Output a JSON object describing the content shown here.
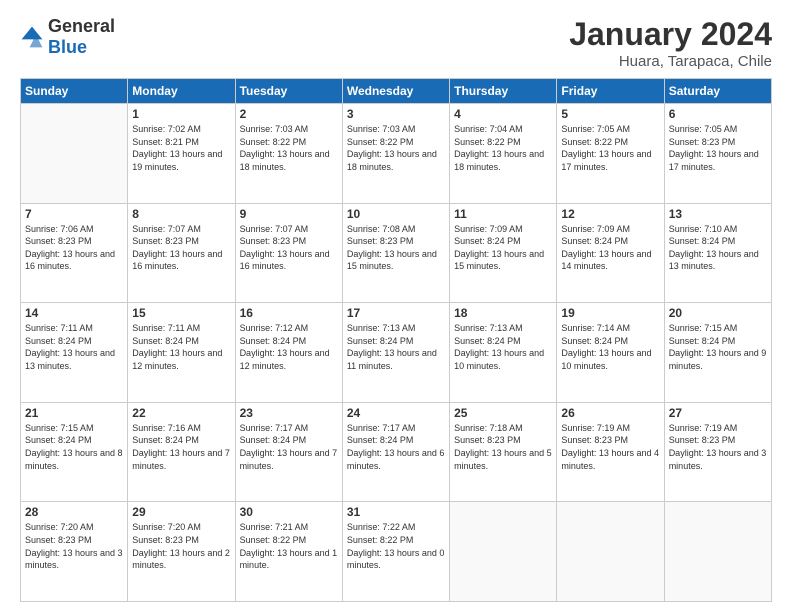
{
  "logo": {
    "general": "General",
    "blue": "Blue"
  },
  "title": "January 2024",
  "subtitle": "Huara, Tarapaca, Chile",
  "headers": [
    "Sunday",
    "Monday",
    "Tuesday",
    "Wednesday",
    "Thursday",
    "Friday",
    "Saturday"
  ],
  "weeks": [
    [
      {
        "day": "",
        "sunrise": "",
        "sunset": "",
        "daylight": ""
      },
      {
        "day": "1",
        "sunrise": "Sunrise: 7:02 AM",
        "sunset": "Sunset: 8:21 PM",
        "daylight": "Daylight: 13 hours and 19 minutes."
      },
      {
        "day": "2",
        "sunrise": "Sunrise: 7:03 AM",
        "sunset": "Sunset: 8:22 PM",
        "daylight": "Daylight: 13 hours and 18 minutes."
      },
      {
        "day": "3",
        "sunrise": "Sunrise: 7:03 AM",
        "sunset": "Sunset: 8:22 PM",
        "daylight": "Daylight: 13 hours and 18 minutes."
      },
      {
        "day": "4",
        "sunrise": "Sunrise: 7:04 AM",
        "sunset": "Sunset: 8:22 PM",
        "daylight": "Daylight: 13 hours and 18 minutes."
      },
      {
        "day": "5",
        "sunrise": "Sunrise: 7:05 AM",
        "sunset": "Sunset: 8:22 PM",
        "daylight": "Daylight: 13 hours and 17 minutes."
      },
      {
        "day": "6",
        "sunrise": "Sunrise: 7:05 AM",
        "sunset": "Sunset: 8:23 PM",
        "daylight": "Daylight: 13 hours and 17 minutes."
      }
    ],
    [
      {
        "day": "7",
        "sunrise": "Sunrise: 7:06 AM",
        "sunset": "Sunset: 8:23 PM",
        "daylight": "Daylight: 13 hours and 16 minutes."
      },
      {
        "day": "8",
        "sunrise": "Sunrise: 7:07 AM",
        "sunset": "Sunset: 8:23 PM",
        "daylight": "Daylight: 13 hours and 16 minutes."
      },
      {
        "day": "9",
        "sunrise": "Sunrise: 7:07 AM",
        "sunset": "Sunset: 8:23 PM",
        "daylight": "Daylight: 13 hours and 16 minutes."
      },
      {
        "day": "10",
        "sunrise": "Sunrise: 7:08 AM",
        "sunset": "Sunset: 8:23 PM",
        "daylight": "Daylight: 13 hours and 15 minutes."
      },
      {
        "day": "11",
        "sunrise": "Sunrise: 7:09 AM",
        "sunset": "Sunset: 8:24 PM",
        "daylight": "Daylight: 13 hours and 15 minutes."
      },
      {
        "day": "12",
        "sunrise": "Sunrise: 7:09 AM",
        "sunset": "Sunset: 8:24 PM",
        "daylight": "Daylight: 13 hours and 14 minutes."
      },
      {
        "day": "13",
        "sunrise": "Sunrise: 7:10 AM",
        "sunset": "Sunset: 8:24 PM",
        "daylight": "Daylight: 13 hours and 13 minutes."
      }
    ],
    [
      {
        "day": "14",
        "sunrise": "Sunrise: 7:11 AM",
        "sunset": "Sunset: 8:24 PM",
        "daylight": "Daylight: 13 hours and 13 minutes."
      },
      {
        "day": "15",
        "sunrise": "Sunrise: 7:11 AM",
        "sunset": "Sunset: 8:24 PM",
        "daylight": "Daylight: 13 hours and 12 minutes."
      },
      {
        "day": "16",
        "sunrise": "Sunrise: 7:12 AM",
        "sunset": "Sunset: 8:24 PM",
        "daylight": "Daylight: 13 hours and 12 minutes."
      },
      {
        "day": "17",
        "sunrise": "Sunrise: 7:13 AM",
        "sunset": "Sunset: 8:24 PM",
        "daylight": "Daylight: 13 hours and 11 minutes."
      },
      {
        "day": "18",
        "sunrise": "Sunrise: 7:13 AM",
        "sunset": "Sunset: 8:24 PM",
        "daylight": "Daylight: 13 hours and 10 minutes."
      },
      {
        "day": "19",
        "sunrise": "Sunrise: 7:14 AM",
        "sunset": "Sunset: 8:24 PM",
        "daylight": "Daylight: 13 hours and 10 minutes."
      },
      {
        "day": "20",
        "sunrise": "Sunrise: 7:15 AM",
        "sunset": "Sunset: 8:24 PM",
        "daylight": "Daylight: 13 hours and 9 minutes."
      }
    ],
    [
      {
        "day": "21",
        "sunrise": "Sunrise: 7:15 AM",
        "sunset": "Sunset: 8:24 PM",
        "daylight": "Daylight: 13 hours and 8 minutes."
      },
      {
        "day": "22",
        "sunrise": "Sunrise: 7:16 AM",
        "sunset": "Sunset: 8:24 PM",
        "daylight": "Daylight: 13 hours and 7 minutes."
      },
      {
        "day": "23",
        "sunrise": "Sunrise: 7:17 AM",
        "sunset": "Sunset: 8:24 PM",
        "daylight": "Daylight: 13 hours and 7 minutes."
      },
      {
        "day": "24",
        "sunrise": "Sunrise: 7:17 AM",
        "sunset": "Sunset: 8:24 PM",
        "daylight": "Daylight: 13 hours and 6 minutes."
      },
      {
        "day": "25",
        "sunrise": "Sunrise: 7:18 AM",
        "sunset": "Sunset: 8:23 PM",
        "daylight": "Daylight: 13 hours and 5 minutes."
      },
      {
        "day": "26",
        "sunrise": "Sunrise: 7:19 AM",
        "sunset": "Sunset: 8:23 PM",
        "daylight": "Daylight: 13 hours and 4 minutes."
      },
      {
        "day": "27",
        "sunrise": "Sunrise: 7:19 AM",
        "sunset": "Sunset: 8:23 PM",
        "daylight": "Daylight: 13 hours and 3 minutes."
      }
    ],
    [
      {
        "day": "28",
        "sunrise": "Sunrise: 7:20 AM",
        "sunset": "Sunset: 8:23 PM",
        "daylight": "Daylight: 13 hours and 3 minutes."
      },
      {
        "day": "29",
        "sunrise": "Sunrise: 7:20 AM",
        "sunset": "Sunset: 8:23 PM",
        "daylight": "Daylight: 13 hours and 2 minutes."
      },
      {
        "day": "30",
        "sunrise": "Sunrise: 7:21 AM",
        "sunset": "Sunset: 8:22 PM",
        "daylight": "Daylight: 13 hours and 1 minute."
      },
      {
        "day": "31",
        "sunrise": "Sunrise: 7:22 AM",
        "sunset": "Sunset: 8:22 PM",
        "daylight": "Daylight: 13 hours and 0 minutes."
      },
      {
        "day": "",
        "sunrise": "",
        "sunset": "",
        "daylight": ""
      },
      {
        "day": "",
        "sunrise": "",
        "sunset": "",
        "daylight": ""
      },
      {
        "day": "",
        "sunrise": "",
        "sunset": "",
        "daylight": ""
      }
    ]
  ]
}
